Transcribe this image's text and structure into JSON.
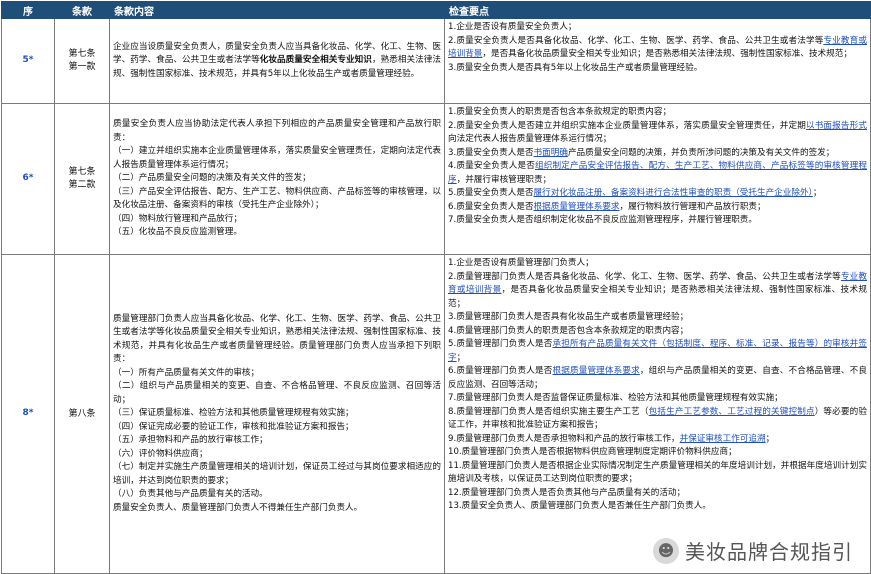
{
  "header": {
    "col_no": "序",
    "col_clause": "条款",
    "col_content": "条款内容",
    "col_points": "检查要点"
  },
  "rows": [
    {
      "no": "5*",
      "clause": [
        "第七条",
        "第一款"
      ],
      "content": [
        "企业应当设质量安全负责人，质量安全负责人应当具备化妆品、化学、化工、生物、医学、药学、食品、公共卫生或者法学等",
        "化妆品质量安全相关专业知识",
        "，熟悉相关法律法规、强制性国家标准、技术规范，并具有5年以上化妆品生产或者质量管理经验。"
      ],
      "points": [
        "1.企业是否设有质量安全负责人；",
        "2.质量安全负责人是否具备化妆品、化学、化工、生物、医学、药学、食品、公共卫生或者法学等",
        "专业教育或培训背景",
        "，是否具备化妆品质量安全相关专业知识；是否熟悉相关法律法规、强制性国家标准、技术规范；",
        "3.质量安全负责人是否具有5年以上化妆品生产或者质量管理经验。"
      ]
    },
    {
      "no": "6*",
      "clause": [
        "第七条",
        "第二款"
      ],
      "content": [
        "质量安全负责人应当协助法定代表人承担下列相应的产品质量安全管理和产品放行职责：",
        "（一）建立并组织实施本企业质量管理体系，落实质量安全管理责任，定期向法定代表人报告质量管理体系运行情况；",
        "（二）产品质量安全问题的决策及有关文件的签发；",
        "（三）产品安全评估报告、配方、生产工艺、物料供应商、产品标签等的审核管理，以及化妆品注册、备案资料的审核（受托生产企业除外）；",
        "（四）物料放行管理和产品放行；",
        "（五）化妆品不良反应监测管理。"
      ],
      "points": [
        "1.质量安全负责人的职责是否包含本条款规定的职责内容；",
        "2.质量安全负责人是否建立并组织实施本企业质量管理体系，落实质量安全管理责任，并定期",
        "以书面报告形式",
        "向法定代表人报告质量管理体系运行情况；",
        "3.质量安全负责人是否",
        "书面明确",
        "产品质量安全问题的决策，并负责所涉问题的决策及有关文件的签发；",
        "4.质量安全负责人是否",
        "组织制定产品安全评估报告、配方、生产工艺、物料供应商、产品标签等的审核管理程序",
        "，并履行审核管理职责；",
        "5.质量安全负责人是否",
        "履行对化妆品注册、备案资料进行合法性审查的职责（受托生产企业除外）",
        "；",
        "6.质量安全负责人是否",
        "根据质量管理体系要求",
        "，履行物料放行管理和产品放行职责；",
        "7.质量安全负责人是否组织制定化妆品不良反应监测管理程序，并履行管理职责。"
      ]
    },
    {
      "no": "8*",
      "clause": [
        "第八条"
      ],
      "content": [
        "质量管理部门负责人应当具备化妆品、化学、化工、生物、医学、药学、食品、公共卫生或者法学等化妆品质量安全相关专业知识，熟悉相关法律法规、强制性国家标准、技术规范，并具有化妆品生产或者质量管理经验。质量管理部门负责人应当承担下列职责：",
        "（一）所有产品质量有关文件的审核；",
        "（二）组织与产品质量相关的变更、自查、不合格品管理、不良反应监测、召回等活动；",
        "（三）保证质量标准、检验方法和其他质量管理规程有效实施；",
        "（四）保证完成必要的验证工作，审核和批准验证方案和报告；",
        "（五）承担物料和产品的放行审核工作；",
        "（六）评价物料供应商；",
        "（七）制定并实施生产质量管理相关的培训计划，保证员工经过与其岗位要求相适应的培训，并达到岗位职责的要求；",
        "（八）负责其他与产品质量有关的活动。",
        "质量安全负责人、质量管理部门负责人不得兼任生产部门负责人。"
      ],
      "points": [
        "1.企业是否设有质量管理部门负责人；",
        "2.质量管理部门负责人是否具备化妆品、化学、化工、生物、医学、药学、食品、公共卫生或者法学等",
        "专业教育或培训背景",
        "，是否具备化妆品质量安全相关专业知识；是否熟悉相关法律法规、强制性国家标准、技术规范；",
        "3.质量管理部门负责人是否具有化妆品生产或者质量管理经验；",
        "4.质量管理部门负责人的职责是否包含本条款规定的职责内容；",
        "5.质量管理部门负责人是否",
        "承担所有产品质量有关文件（包括制度、程序、标准、记录、报告等）的审核并签字",
        "；",
        "6.质量管理部门负责人是否",
        "根据质量管理体系要求",
        "，组织与产品质量相关的变更、自查、不合格品管理、不良反应监测、召回等活动；",
        "7.质量管理部门负责人是否监督保证质量标准、检验方法和其他质量管理规程有效实施；",
        "8.质量管理部门负责人是否组织实施主要生产工艺（",
        "包括生产工艺参数、工艺过程的关键控制点",
        "）等必要的验证工作，并审核和批准验证方案和报告；",
        "9.质量管理部门负责人是否承担物料和产品的放行审核工作，",
        "并保证审核工作可追溯",
        "；",
        "10.质量管理部门负责人是否根据物料供应商管理制度定期评价物料供应商；",
        "11.质量管理部门负责人是否根据企业实际情况制定生产质量管理相关的年度培训计划，并根据年度培训计划实施培训及考核，以保证员工达到岗位职责的要求；",
        "12.质量管理部门负责人是否负责其他与产品质量有关的活动；",
        "13.质量安全负责人、质量管理部门负责人是否兼任生产部门负责人。"
      ]
    }
  ],
  "watermark": {
    "icon": "wechat-icon",
    "text": "美妆品牌合规指引"
  }
}
